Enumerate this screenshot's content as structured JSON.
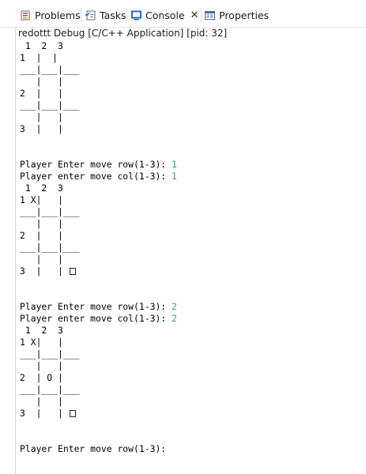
{
  "tabs": [
    {
      "label": "Problems",
      "icon": "problems-icon",
      "active": false
    },
    {
      "label": "Tasks",
      "icon": "tasks-icon",
      "active": false
    },
    {
      "label": "Console",
      "icon": "console-icon",
      "active": true
    },
    {
      "label": "Properties",
      "icon": "properties-icon",
      "active": false
    }
  ],
  "console": {
    "title": "redottt Debug [C/C++ Application]  [pid: 32]",
    "input_color": "#2aa876",
    "lines": [
      " 1  2  3",
      "1  |  |",
      "___|___|___",
      "   |   |",
      "2  |   |",
      "___|___|___",
      "   |   |",
      "3  |   |",
      "",
      "",
      "Player Enter move row(1-3): 1",
      "Player enter move col(1-3): 1",
      " 1  2  3",
      "1 X|   |",
      "___|___|___",
      "   |   |",
      "2  |   |",
      "___|___|___",
      "   |   |",
      "3  |   | ",
      "",
      "",
      "Player Enter move row(1-3): 2",
      "Player enter move col(1-3): 2",
      " 1  2  3",
      "1 X|   |",
      "___|___|___",
      "   |   |",
      "2  | O |",
      "___|___|___",
      "   |   |",
      "3  |   | ",
      "",
      "",
      "Player Enter move row(1-3):"
    ]
  }
}
